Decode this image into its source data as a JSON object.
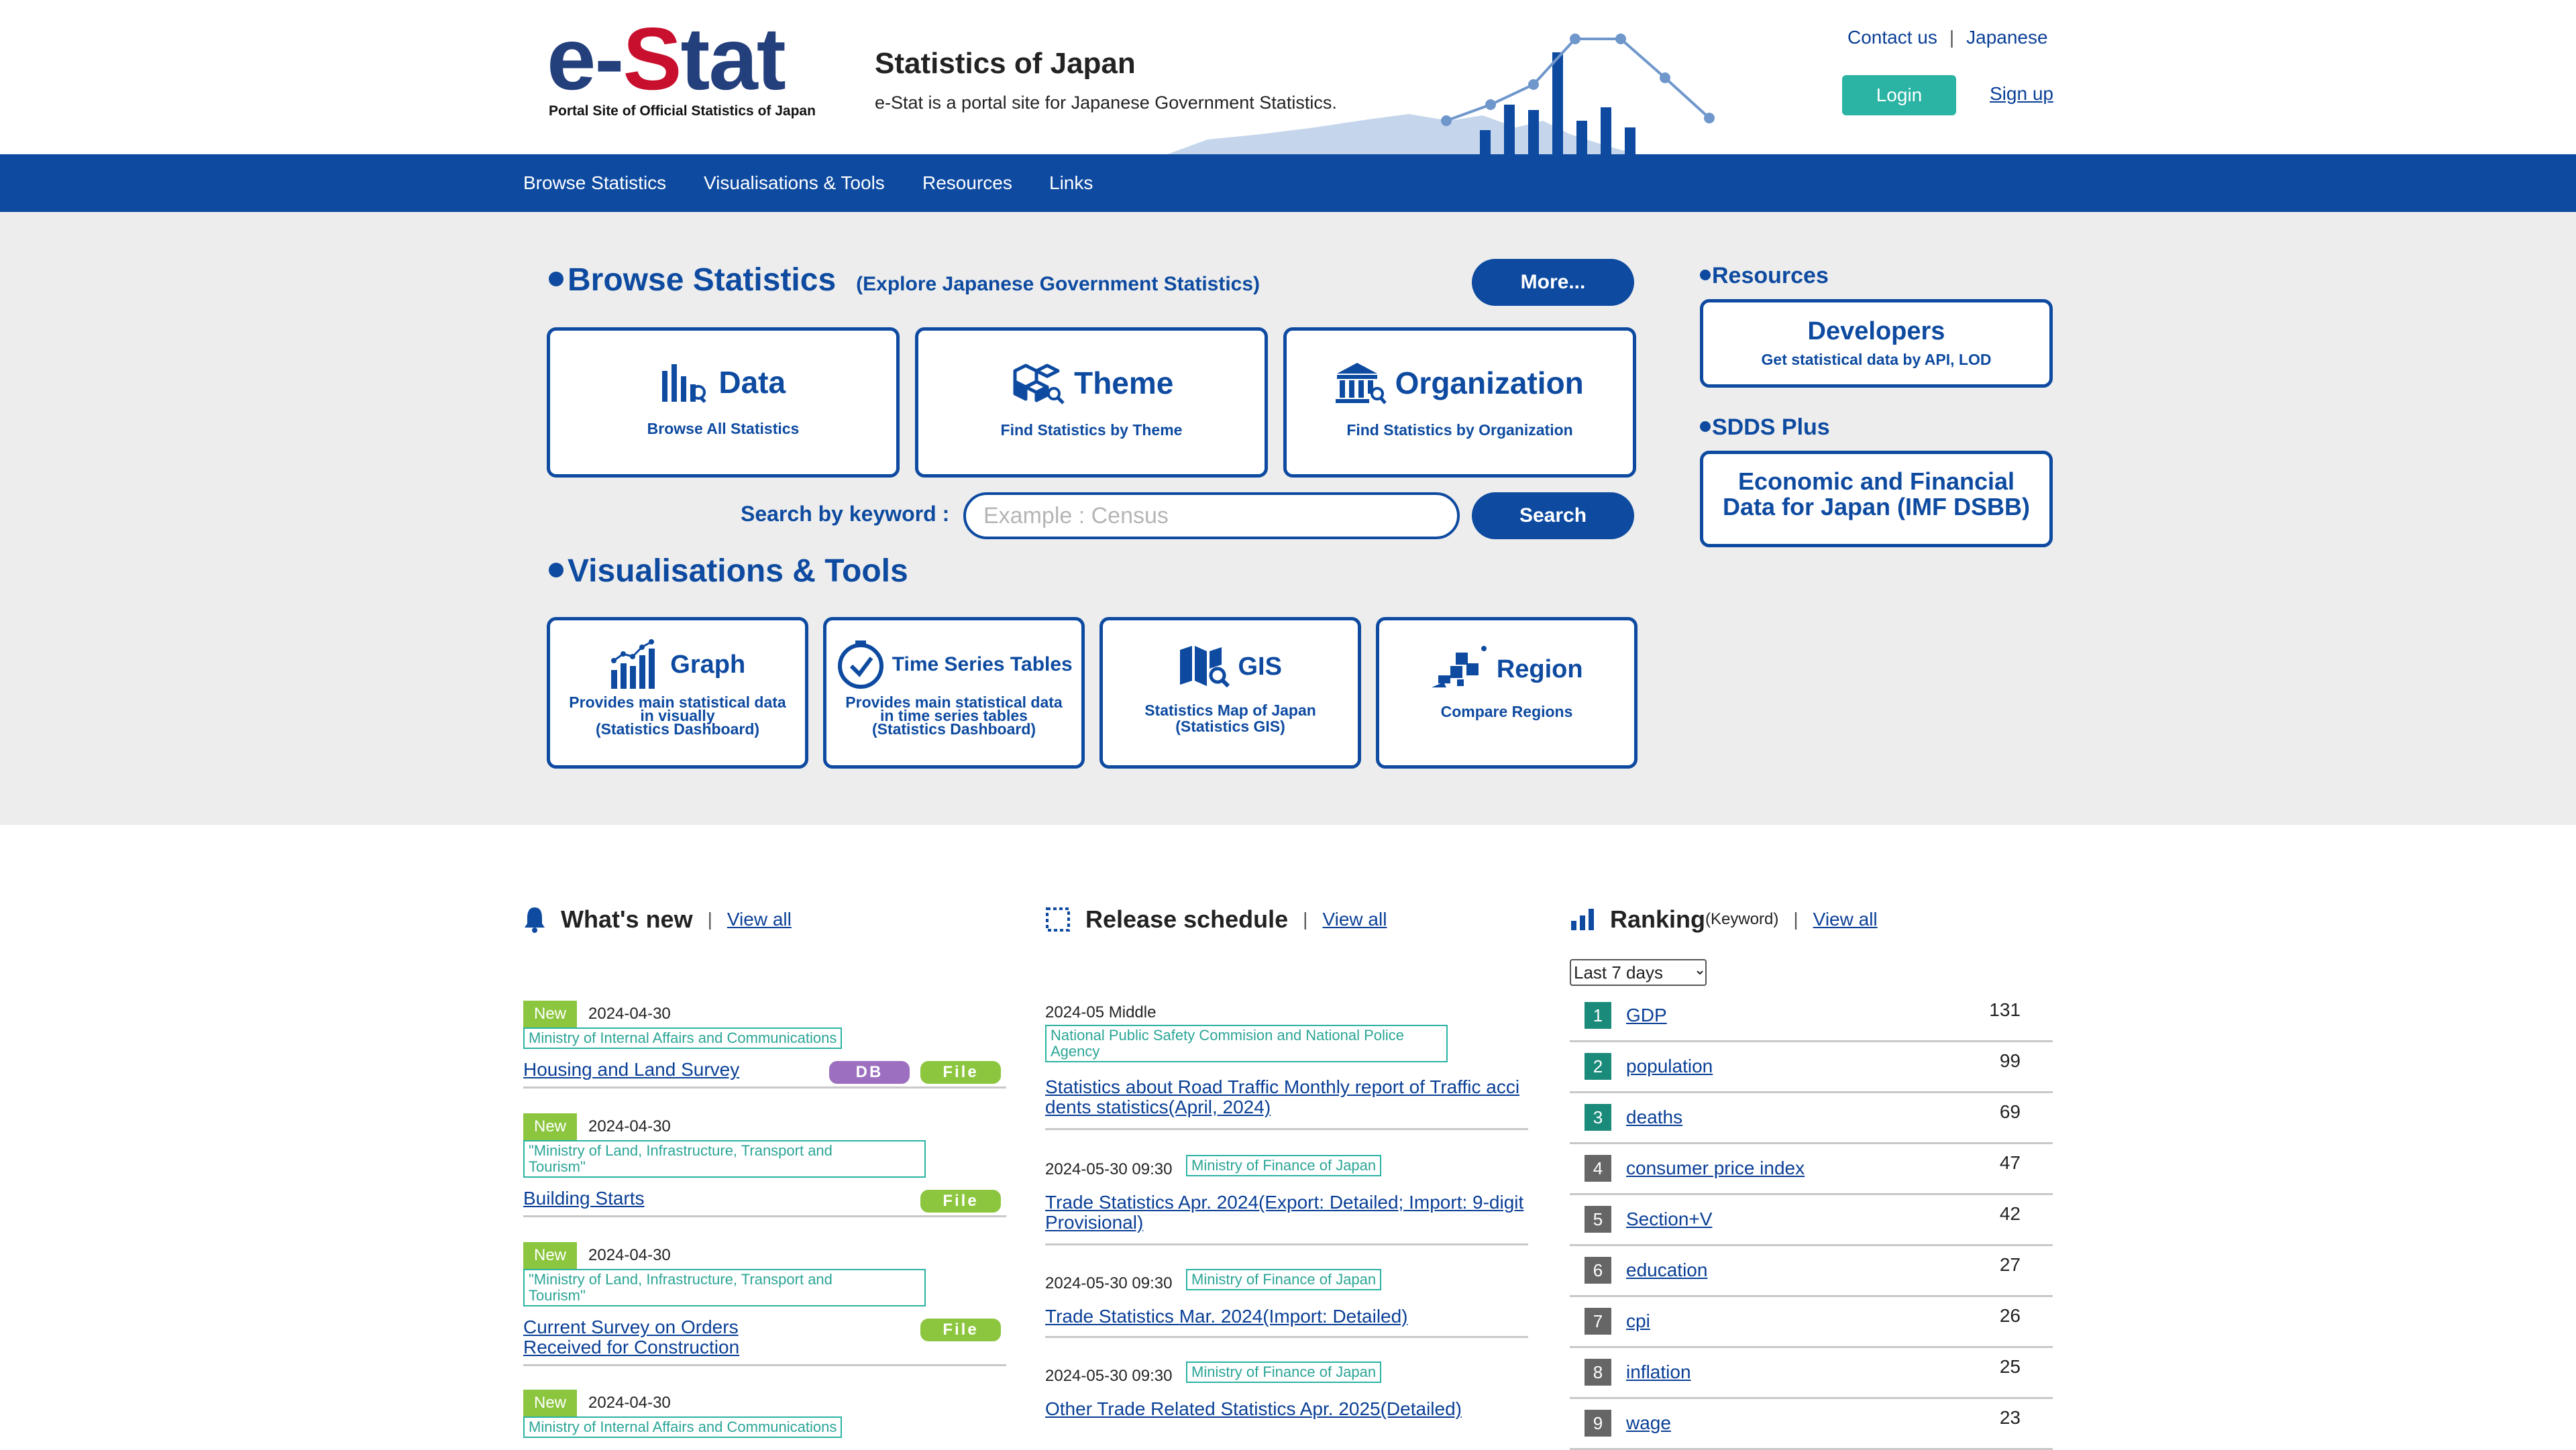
{
  "header": {
    "logo_text_1": "e-",
    "logo_text_2": "S",
    "logo_text_3": "tat",
    "logo_sub": "Portal Site of Official Statistics of Japan",
    "title": "Statistics of Japan",
    "description": "e-Stat is a portal site for Japanese Government Statistics.",
    "contact": "Contact us",
    "separator": "|",
    "japanese": "Japanese",
    "login": "Login",
    "signup": "Sign up"
  },
  "nav": [
    "Browse Statistics",
    "Visualisations & Tools",
    "Resources",
    "Links"
  ],
  "browse": {
    "title": "Browse Statistics",
    "subtitle": "(Explore Japanese Government Statistics)",
    "more": "More...",
    "cards": [
      {
        "title": "Data",
        "sub": "Browse All Statistics",
        "icon": "bar-chart-search-icon"
      },
      {
        "title": "Theme",
        "sub": "Find Statistics by Theme",
        "icon": "cubes-search-icon"
      },
      {
        "title": "Organization",
        "sub": "Find Statistics by Organization",
        "icon": "building-search-icon"
      }
    ],
    "search_label": "Search by keyword :",
    "search_placeholder": "Example : Census",
    "search_button": "Search"
  },
  "vis": {
    "title": "Visualisations & Tools",
    "cards": [
      {
        "title": "Graph",
        "sub": [
          "Provides main statistical data",
          "in visually",
          "(Statistics Dashboard)"
        ],
        "icon": "graph-icon"
      },
      {
        "title": "Time Series Tables",
        "sub": [
          "Provides main statistical data",
          "in time series tables",
          "(Statistics Dashboard)"
        ],
        "icon": "clock-icon"
      },
      {
        "title": "GIS",
        "sub": [
          "Statistics Map of Japan",
          "(Statistics GIS)"
        ],
        "icon": "map-search-icon"
      },
      {
        "title": "Region",
        "sub": [
          "Compare Regions"
        ],
        "icon": "region-icon"
      }
    ]
  },
  "resources": {
    "title": "Resources",
    "dev_title": "Developers",
    "dev_sub": "Get statistical data by API, LOD",
    "sdds_title": "SDDS Plus",
    "sdds_line1": "Economic and Financial",
    "sdds_line2": "Data for Japan (IMF DSBB)"
  },
  "whats_new": {
    "title": "What's new",
    "sep": "|",
    "view_all": "View all",
    "items": [
      {
        "badge": "New",
        "date": "2024-04-30",
        "ministry": [
          "Ministry of Internal Affairs and Communications"
        ],
        "link": [
          "Housing and Land Survey"
        ],
        "tags": [
          "DB",
          "File"
        ]
      },
      {
        "badge": "New",
        "date": "2024-04-30",
        "ministry": [
          "\"Ministry of Land, Infrastructure, Transport and",
          "Tourism\""
        ],
        "link": [
          "Building Starts"
        ],
        "tags": [
          "File"
        ]
      },
      {
        "badge": "New",
        "date": "2024-04-30",
        "ministry": [
          "\"Ministry of Land, Infrastructure, Transport and",
          "Tourism\""
        ],
        "link": [
          "Current Survey on Orders",
          "Received for Construction"
        ],
        "tags": [
          "File"
        ]
      },
      {
        "badge": "New",
        "date": "2024-04-30",
        "ministry": [
          "Ministry of Internal Affairs and Communications"
        ],
        "link": [],
        "tags": []
      }
    ]
  },
  "release": {
    "title": "Release schedule",
    "sep": "|",
    "view_all": "View all",
    "items": [
      {
        "date": "2024-05 Middle",
        "ministry": [
          "National Public Safety Commision and National Police",
          "Agency"
        ],
        "link": [
          "Statistics about Road Traffic Monthly report of Traffic acci",
          "dents statistics(April, 2024)"
        ]
      },
      {
        "date": "2024-05-30 09:30",
        "ministry": [
          "Ministry of Finance of Japan"
        ],
        "link": [
          "Trade Statistics Apr. 2024(Export: Detailed; Import: 9-digit",
          "Provisional)"
        ]
      },
      {
        "date": "2024-05-30 09:30",
        "ministry": [
          "Ministry of Finance of Japan"
        ],
        "link": [
          "Trade Statistics Mar. 2024(Import: Detailed)"
        ]
      },
      {
        "date": "2024-05-30 09:30",
        "ministry": [
          "Ministry of Finance of Japan"
        ],
        "link": [
          "Other Trade Related Statistics Apr. 2025(Detailed)"
        ]
      }
    ]
  },
  "ranking": {
    "title": "Ranking",
    "title_note": "(Keyword)",
    "sep": "|",
    "view_all": "View all",
    "period": "Last 7 days",
    "rows": [
      {
        "rank": "1",
        "keyword": "GDP",
        "count": "131"
      },
      {
        "rank": "2",
        "keyword": "population",
        "count": "99"
      },
      {
        "rank": "3",
        "keyword": "deaths",
        "count": "69"
      },
      {
        "rank": "4",
        "keyword": "consumer price index",
        "count": "47"
      },
      {
        "rank": "5",
        "keyword": "Section+V",
        "count": "42"
      },
      {
        "rank": "6",
        "keyword": "education",
        "count": "27"
      },
      {
        "rank": "7",
        "keyword": "cpi",
        "count": "26"
      },
      {
        "rank": "8",
        "keyword": "inflation",
        "count": "25"
      },
      {
        "rank": "9",
        "keyword": "wage",
        "count": "23"
      }
    ]
  },
  "colors": {
    "brand_blue": "#0d4aa0",
    "logo_red": "#c8102e",
    "teal": "#2bb3a3",
    "new_green": "#8cc63f",
    "db_purple": "#9c6fc0",
    "rank_top3": "#1a8a7a",
    "rank_rest": "#666666"
  }
}
